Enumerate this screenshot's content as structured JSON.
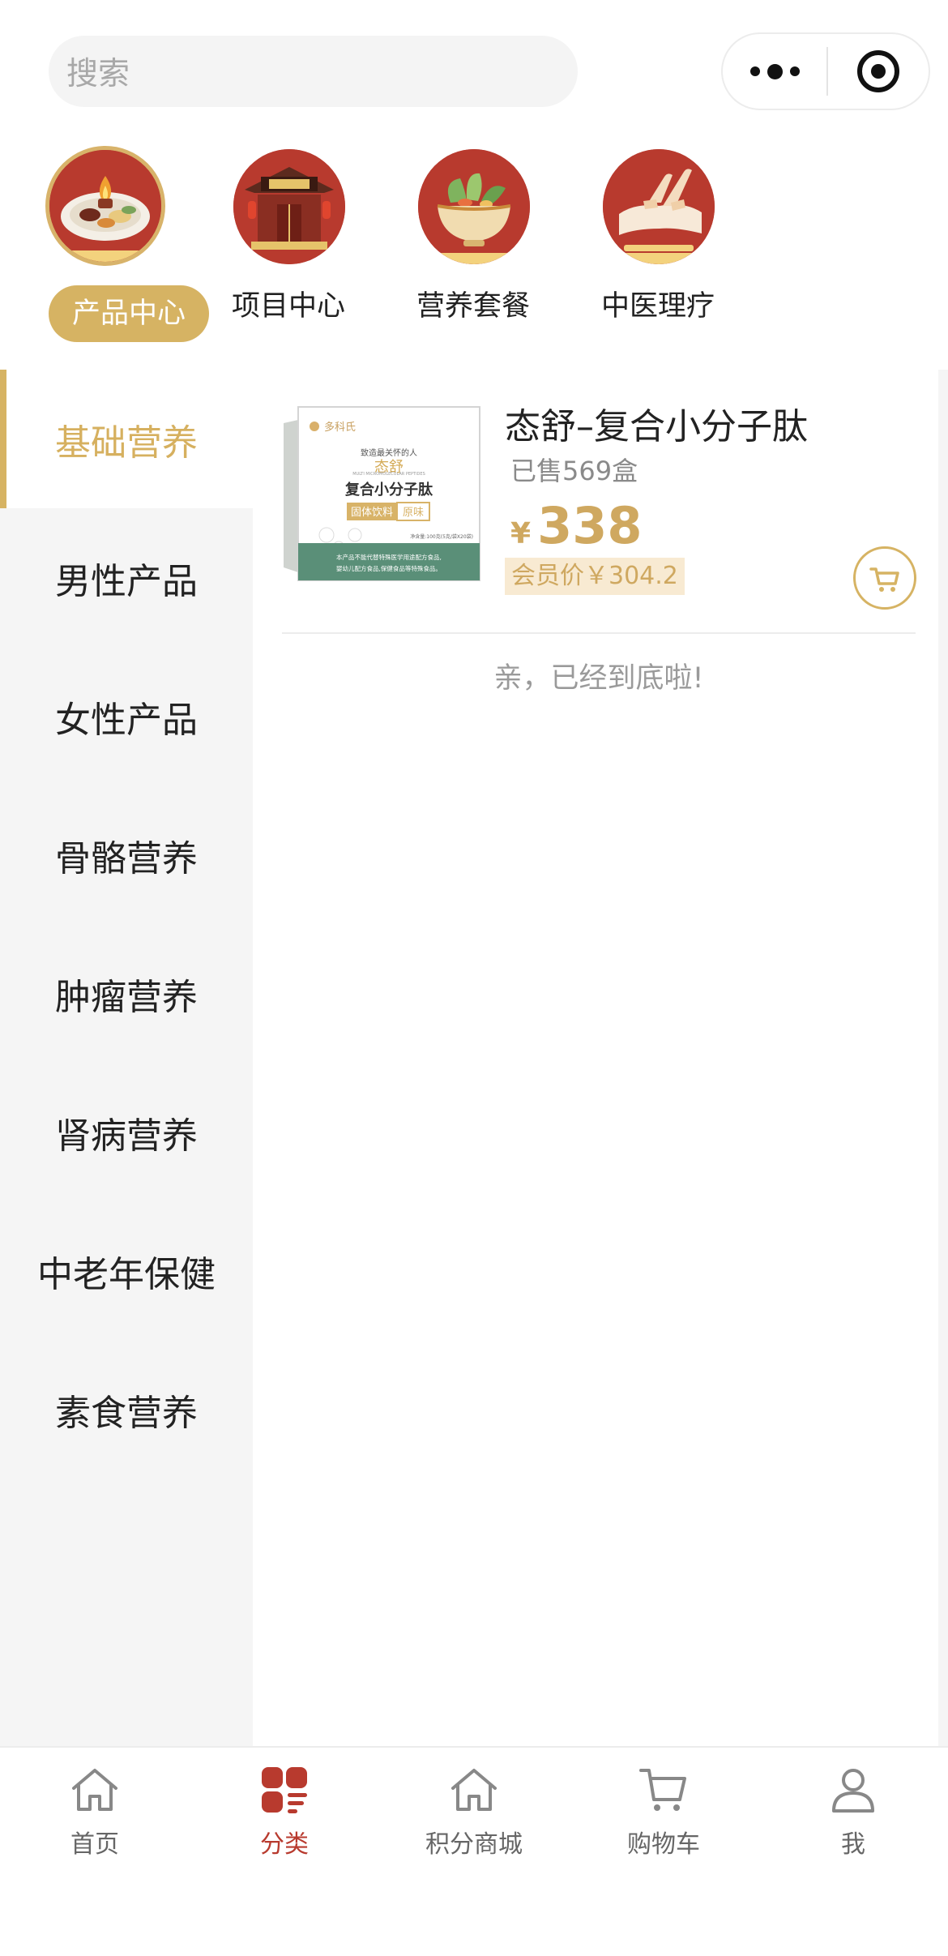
{
  "search": {
    "placeholder": "搜索"
  },
  "capsule": {
    "more_icon": "more-dots-icon",
    "close_icon": "target-circle-icon"
  },
  "categories": [
    {
      "label": "产品中心",
      "icon": "food-plate-icon",
      "active": true
    },
    {
      "label": "项目中心",
      "icon": "clinic-building-icon",
      "active": false
    },
    {
      "label": "营养套餐",
      "icon": "vegetable-bowl-icon",
      "active": false
    },
    {
      "label": "中医理疗",
      "icon": "massage-icon",
      "active": false
    }
  ],
  "sidebar": {
    "items": [
      {
        "label": "基础营养",
        "active": true
      },
      {
        "label": "男性产品"
      },
      {
        "label": "女性产品"
      },
      {
        "label": "骨骼营养"
      },
      {
        "label": "肿瘤营养"
      },
      {
        "label": "肾病营养"
      },
      {
        "label": "中老年保健"
      },
      {
        "label": "素食营养"
      }
    ]
  },
  "product": {
    "title": "态舒–复合小分子肽",
    "sold": "已售569盒",
    "price_symbol": "¥",
    "price": "338",
    "member_price": "会员价￥304.2",
    "package": {
      "brand": "多科氏",
      "tagline": "致造最关怀的人",
      "name_cn": "态舒",
      "product_name": "复合小分子肽",
      "subtitle_en": "MULTI MICROMOLECULAR PEPTIDES",
      "tag_type": "固体饮料",
      "tag_flavor": "原味",
      "net_weight": "净含量:100克(5克/袋X20袋)",
      "footer_line1": "本产品不能代替特殊医学用途配方食品,",
      "footer_line2": "婴幼儿配方食品,保健食品等特殊食品。"
    }
  },
  "end_tip": "亲，已经到底啦!",
  "tabbar": {
    "items": [
      {
        "label": "首页",
        "icon": "home-icon",
        "active": false
      },
      {
        "label": "分类",
        "icon": "category-icon",
        "active": true
      },
      {
        "label": "积分商城",
        "icon": "points-mall-icon",
        "active": false
      },
      {
        "label": "购物车",
        "icon": "cart-icon",
        "active": false
      },
      {
        "label": "我",
        "icon": "user-icon",
        "active": false
      }
    ]
  },
  "colors": {
    "gold": "#d6b363",
    "red": "#b83a2e",
    "gray_bg": "#f5f5f5"
  }
}
